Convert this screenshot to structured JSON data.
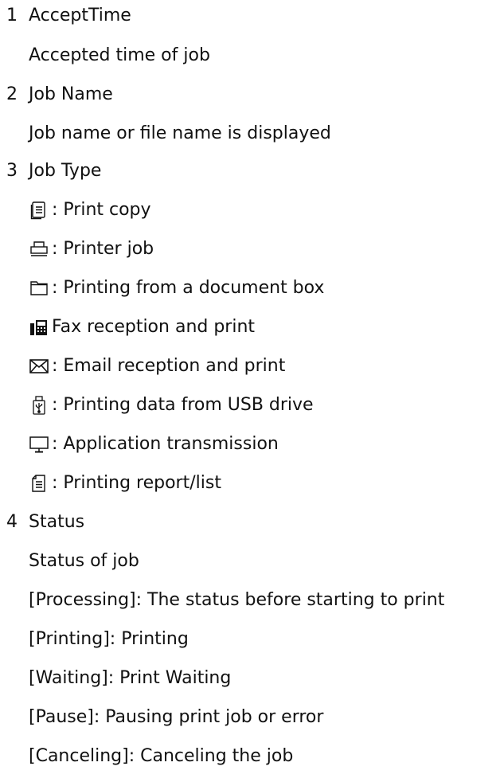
{
  "sections": [
    {
      "number": "1",
      "title": "AcceptTime",
      "lines": [
        "Accepted time of job"
      ]
    },
    {
      "number": "2",
      "title": "Job Name",
      "lines": [
        "Job name or file name is displayed"
      ]
    },
    {
      "number": "3",
      "title": "Job Type",
      "job_types": [
        {
          "icon": "copy-icon",
          "text": ": Print copy"
        },
        {
          "icon": "printer-icon",
          "text": ": Printer job"
        },
        {
          "icon": "folder-icon",
          "text": ": Printing from a document box"
        },
        {
          "icon": "fax-icon",
          "text": " Fax reception and print"
        },
        {
          "icon": "email-icon",
          "text": ": Email reception and print"
        },
        {
          "icon": "usb-drive-icon",
          "text": ": Printing data from USB drive"
        },
        {
          "icon": "monitor-icon",
          "text": ": Application transmission"
        },
        {
          "icon": "report-icon",
          "text": ": Printing report/list"
        }
      ]
    },
    {
      "number": "4",
      "title": "Status",
      "lines": [
        "Status of job",
        "[Processing]: The status before starting to print",
        "[Printing]: Printing",
        "[Waiting]: Print Waiting",
        "[Pause]: Pausing print job or error",
        "[Canceling]: Canceling the job"
      ]
    }
  ]
}
